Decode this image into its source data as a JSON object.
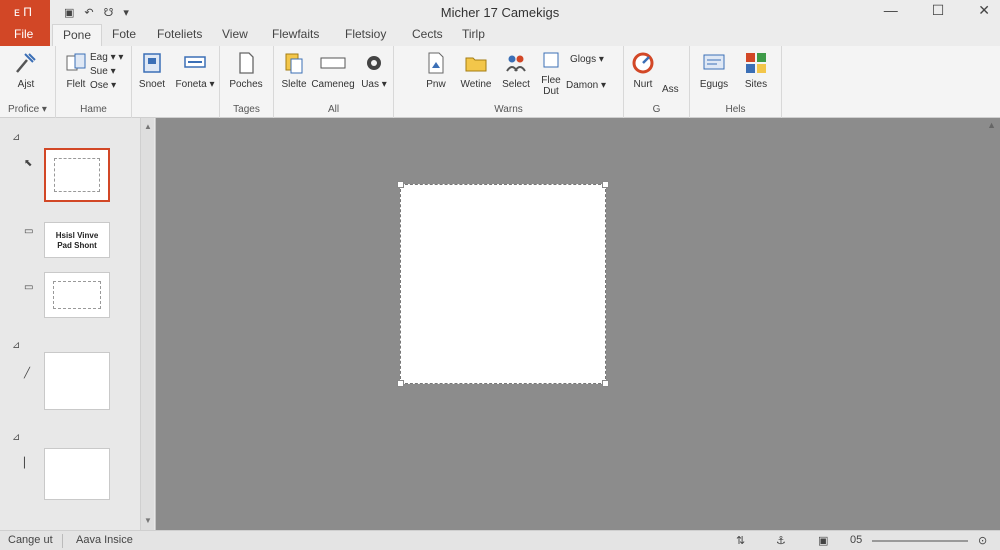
{
  "window": {
    "title": "Micher 17 Camekigs",
    "app_badge": "ᴇ Π",
    "accent": "#d24726"
  },
  "quick_access": {
    "save": "▣",
    "undo": "↶",
    "redo": "☋",
    "more": "▾"
  },
  "window_controls": {
    "minimize": "—",
    "restore": "☐",
    "close": "✕"
  },
  "tabs": {
    "file": "File",
    "home": "Pone",
    "t2": "Fote",
    "t3": "Foteliets",
    "t4": "View",
    "t5": "Flewfaits",
    "t6": "Fletsioy",
    "t7": "Cects",
    "t8": "Tirlp"
  },
  "ribbon": {
    "groups": {
      "g1": "Profice ▾",
      "g2": "Hame",
      "g3": "Tages",
      "g4": "All",
      "g5": "Warns",
      "g6": "G",
      "g7": "Hels"
    },
    "buttons": {
      "b1": "Ajst",
      "b2": "Flelt",
      "b2a": "Eag ▾ ▾",
      "b2b": "Sue ▾",
      "b2c": "Ose ▾",
      "b3": "Snoet",
      "b4": "Foneta ▾",
      "b5": "Poches",
      "b6": "Slelte",
      "b7": "Cameneg",
      "b8": "Uas ▾",
      "b9": "Pnw",
      "b10": "Wetine",
      "b11": "Select",
      "b12a": "Flee",
      "b12b": "Dut",
      "b13": "Glogs ▾",
      "b14": "Damon ▾",
      "b15": "Nurt",
      "b16": "Ass",
      "b17": "Egugs",
      "b18": "Sites"
    }
  },
  "slides_panel": {
    "section1": "⊿",
    "section2": "⊿",
    "section3": "⊿",
    "slide2_text": "Hsisl Vinve Pad Shont",
    "scroll_up": "▲",
    "scroll_down": "▼"
  },
  "statusbar": {
    "left": "Cange ut",
    "middle": "Aava Insice",
    "zoom_label": "05"
  }
}
